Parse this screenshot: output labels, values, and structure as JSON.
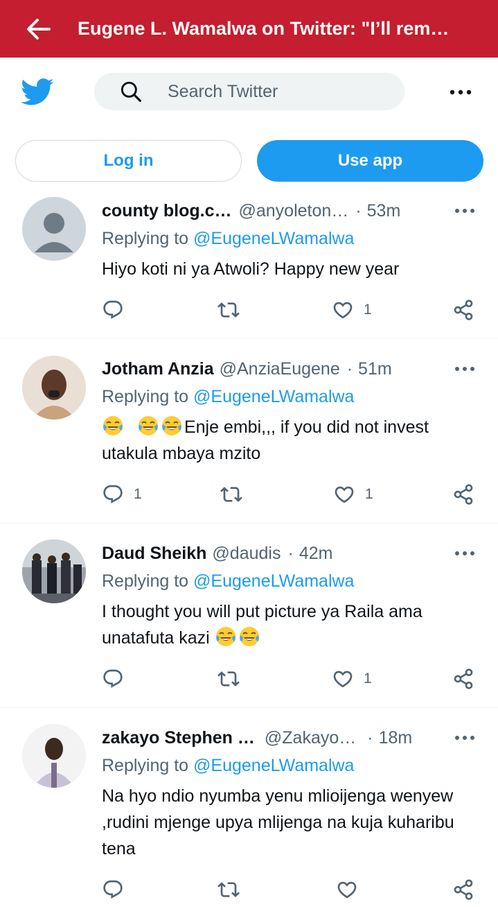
{
  "topbar": {
    "title": "Eugene L. Wamalwa on Twitter: \"I’ll rem…"
  },
  "search": {
    "placeholder": "Search Twitter"
  },
  "buttons": {
    "login": "Log in",
    "use_app": "Use app"
  },
  "colors": {
    "brand_red": "#c41e30",
    "twitter_blue": "#1d9bf0",
    "secondary_text": "#536471"
  },
  "replying_prefix": "Replying to",
  "tweets": [
    {
      "name": "county blog.c…",
      "handle": "@anyoleton…",
      "time": "53m",
      "reply_to": "@EugeneLWamalwa",
      "text": "Hiyo koti ni ya Atwoli? Happy new year",
      "reply_count": "",
      "like_count": "1"
    },
    {
      "name": "Jotham Anzia",
      "handle": "@AnziaEugene",
      "time": "51m",
      "reply_to": "@EugeneLWamalwa",
      "text_line1": "Enje embi,,, if you did  not invest",
      "text_line2": "utakula mbaya mzito",
      "emoji": "face-with-tears-of-joy",
      "reply_count": "1",
      "like_count": "1"
    },
    {
      "name": "Daud Sheikh",
      "handle": "@daudis",
      "time": "42m",
      "reply_to": "@EugeneLWamalwa",
      "text_line1": "I thought you will put picture ya Raila ama",
      "text_line2": "unatafuta kazi",
      "emoji": "face-with-tears-of-joy",
      "reply_count": "",
      "like_count": "1"
    },
    {
      "name": "zakayo Stephen …",
      "handle": "@Zakayo…",
      "time": "18m",
      "reply_to": "@EugeneLWamalwa",
      "text": "Na hyo ndio nyumba yenu mlioijenga wenyew ,rudini mjenge upya mlijenga na kuja kuharibu tena",
      "reply_count": "",
      "like_count": ""
    }
  ]
}
